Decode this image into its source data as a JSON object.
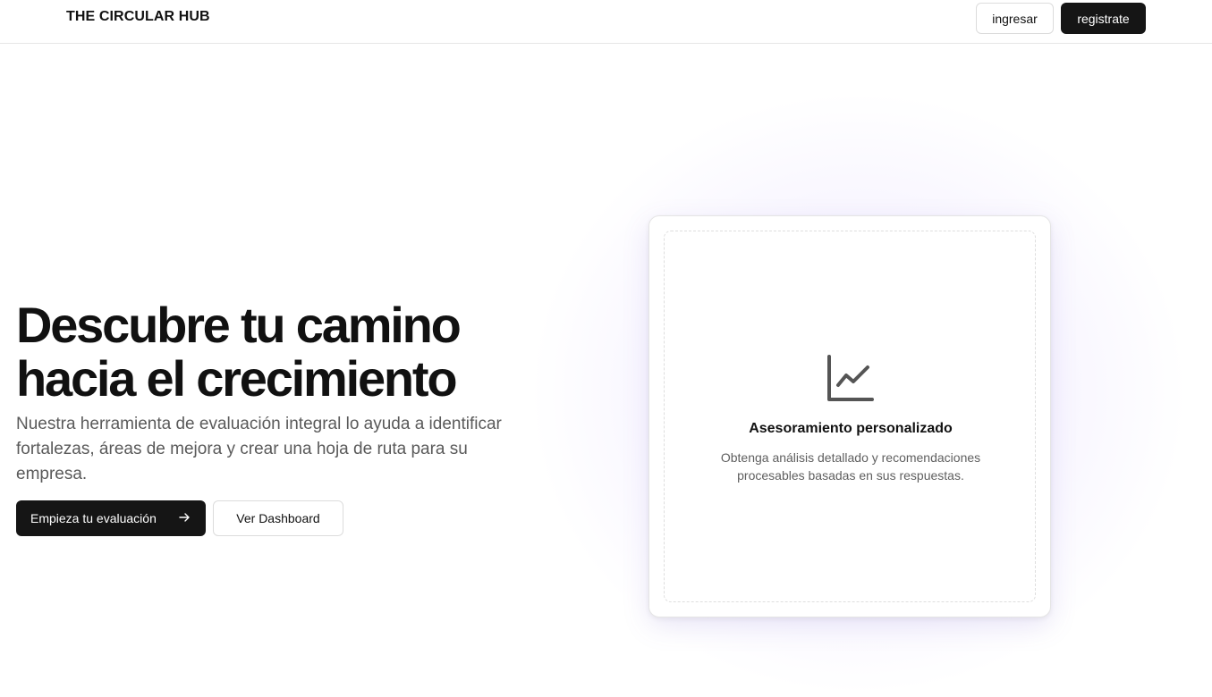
{
  "header": {
    "brand": "THE CIRCULAR HUB",
    "login_label": "ingresar",
    "register_label": "registrate"
  },
  "hero": {
    "title_line1": "Descubre tu camino",
    "title_line2": "hacia el crecimiento",
    "description": "Nuestra herramienta de evaluación integral lo ayuda a identificar fortalezas, áreas de mejora y crear una hoja de ruta para su empresa.",
    "start_label": "Empieza tu evaluación",
    "dashboard_label": "Ver Dashboard"
  },
  "card": {
    "icon": "line-chart-icon",
    "title": "Asesoramiento personalizado",
    "text": "Obtenga análisis detallado y recomendaciones procesables basadas en sus respuestas."
  },
  "colors": {
    "primary": "#151515",
    "muted_text": "#5a5a5a",
    "glow": "#c8b9ff"
  }
}
